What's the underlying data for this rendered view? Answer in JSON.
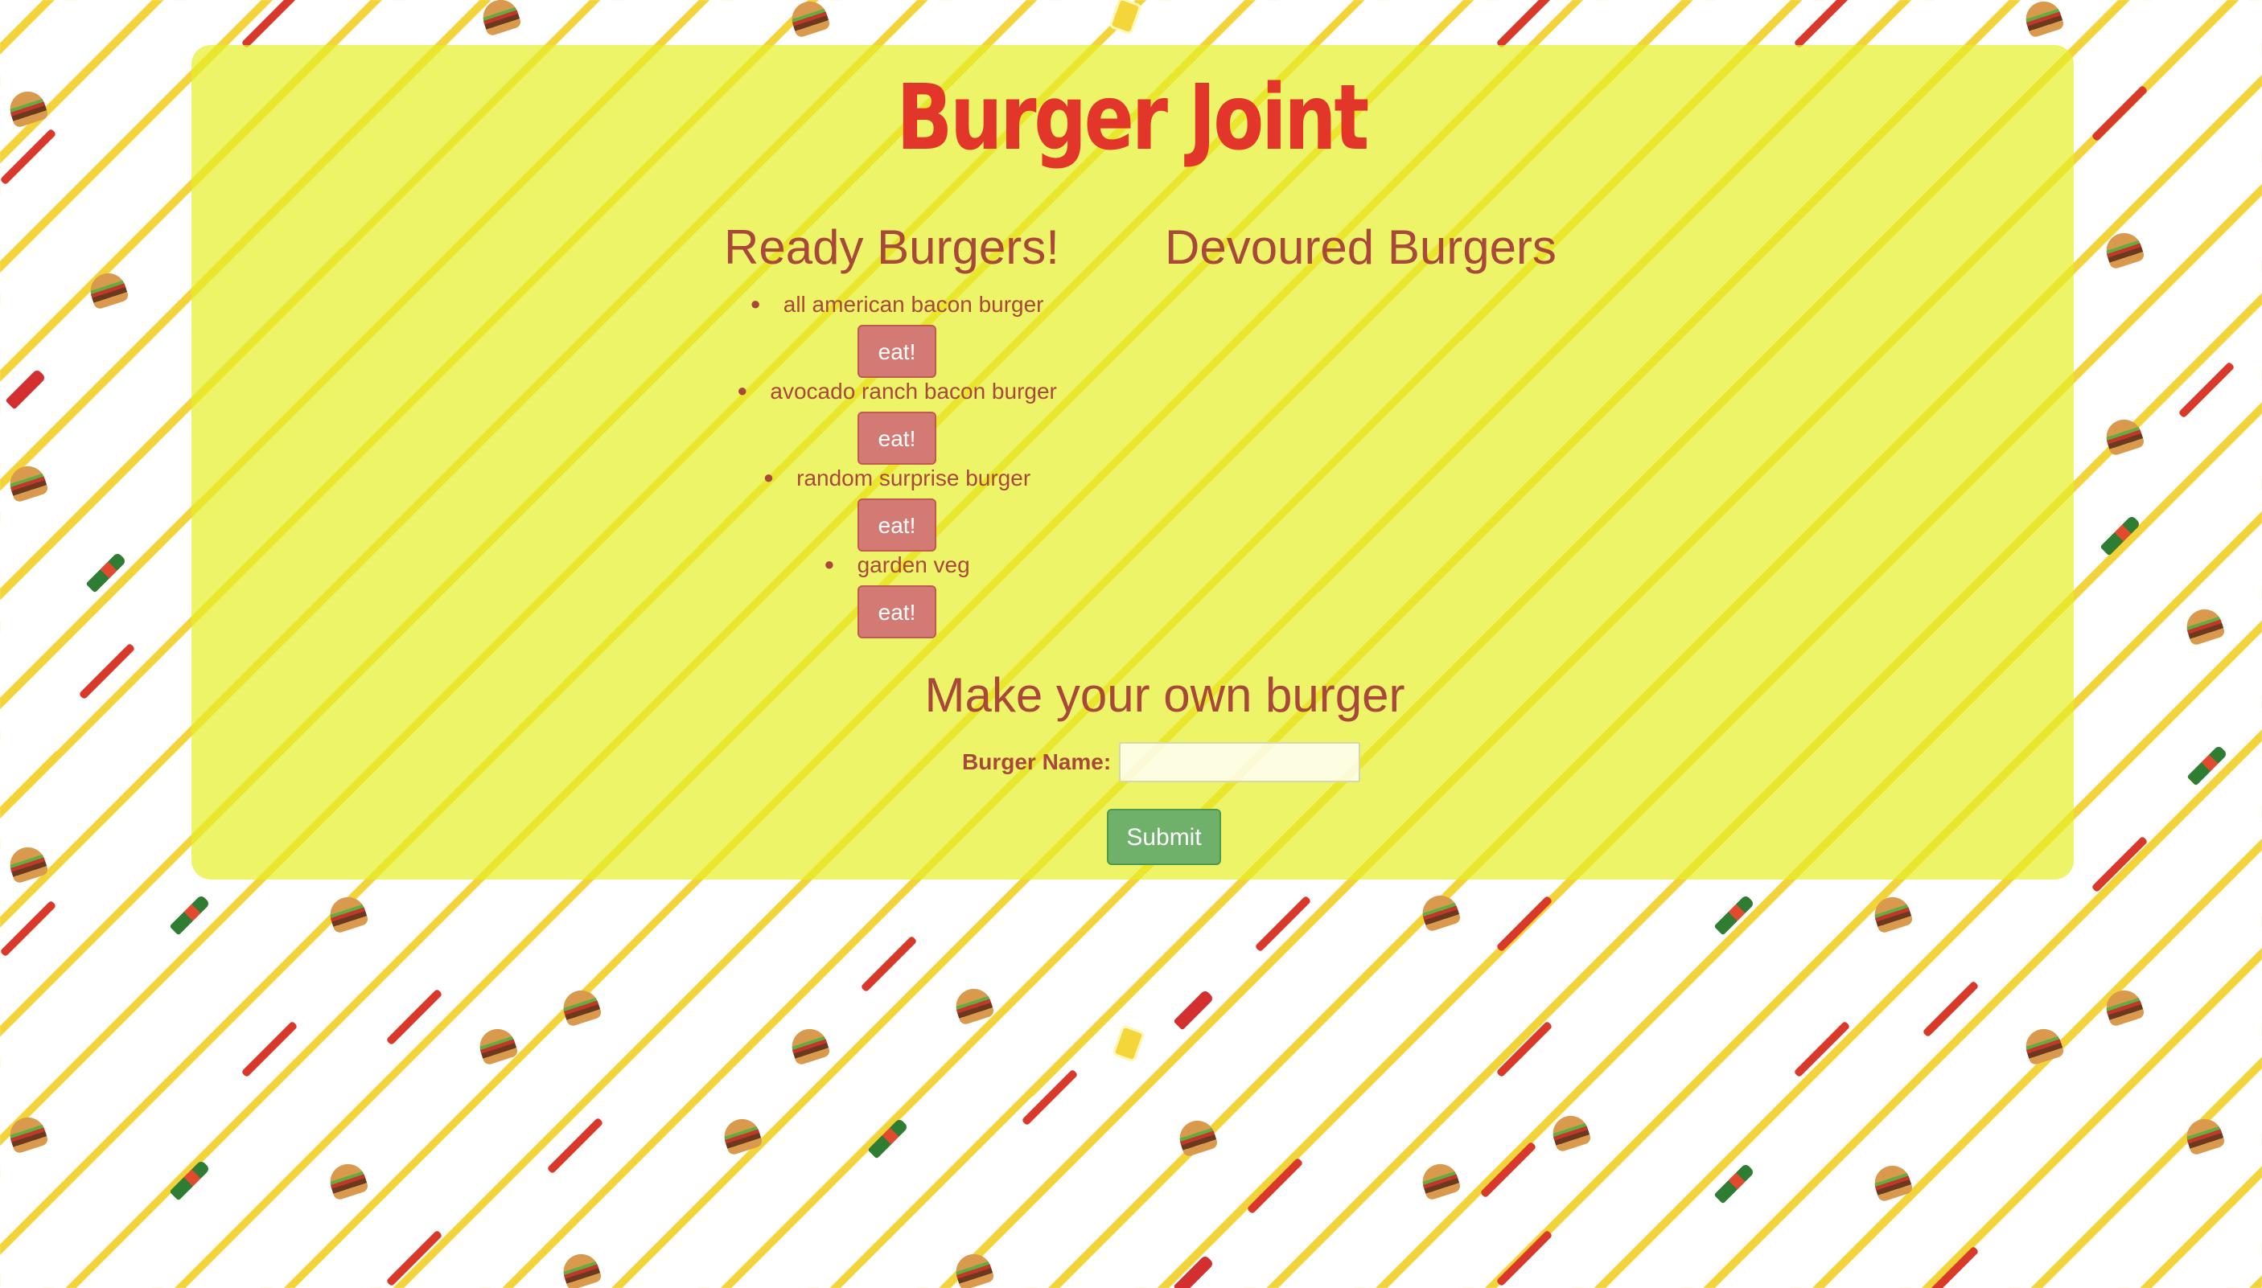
{
  "header": {
    "title": "Burger Joint"
  },
  "ready": {
    "title": "Ready Burgers!",
    "items": [
      {
        "name": "all american bacon burger",
        "button": "eat!"
      },
      {
        "name": "avocado ranch bacon burger",
        "button": "eat!"
      },
      {
        "name": "random surprise burger",
        "button": "eat!"
      },
      {
        "name": "garden veg",
        "button": "eat!"
      }
    ]
  },
  "devoured": {
    "title": "Devoured Burgers",
    "items": []
  },
  "form": {
    "title": "Make your own burger",
    "label": "Burger Name:",
    "value": "",
    "placeholder": "",
    "submit_label": "Submit"
  },
  "colors": {
    "title": "#e3362a",
    "text": "#a8483a",
    "panel": "#e6f028",
    "eat_button": "#d47a74",
    "submit_button": "#6fb16a"
  },
  "background": {
    "icons": [
      "burger-icon",
      "hot-sauce-bottle-icon",
      "ketchup-bottle-icon",
      "mustard-icon",
      "fries-stripe"
    ]
  }
}
